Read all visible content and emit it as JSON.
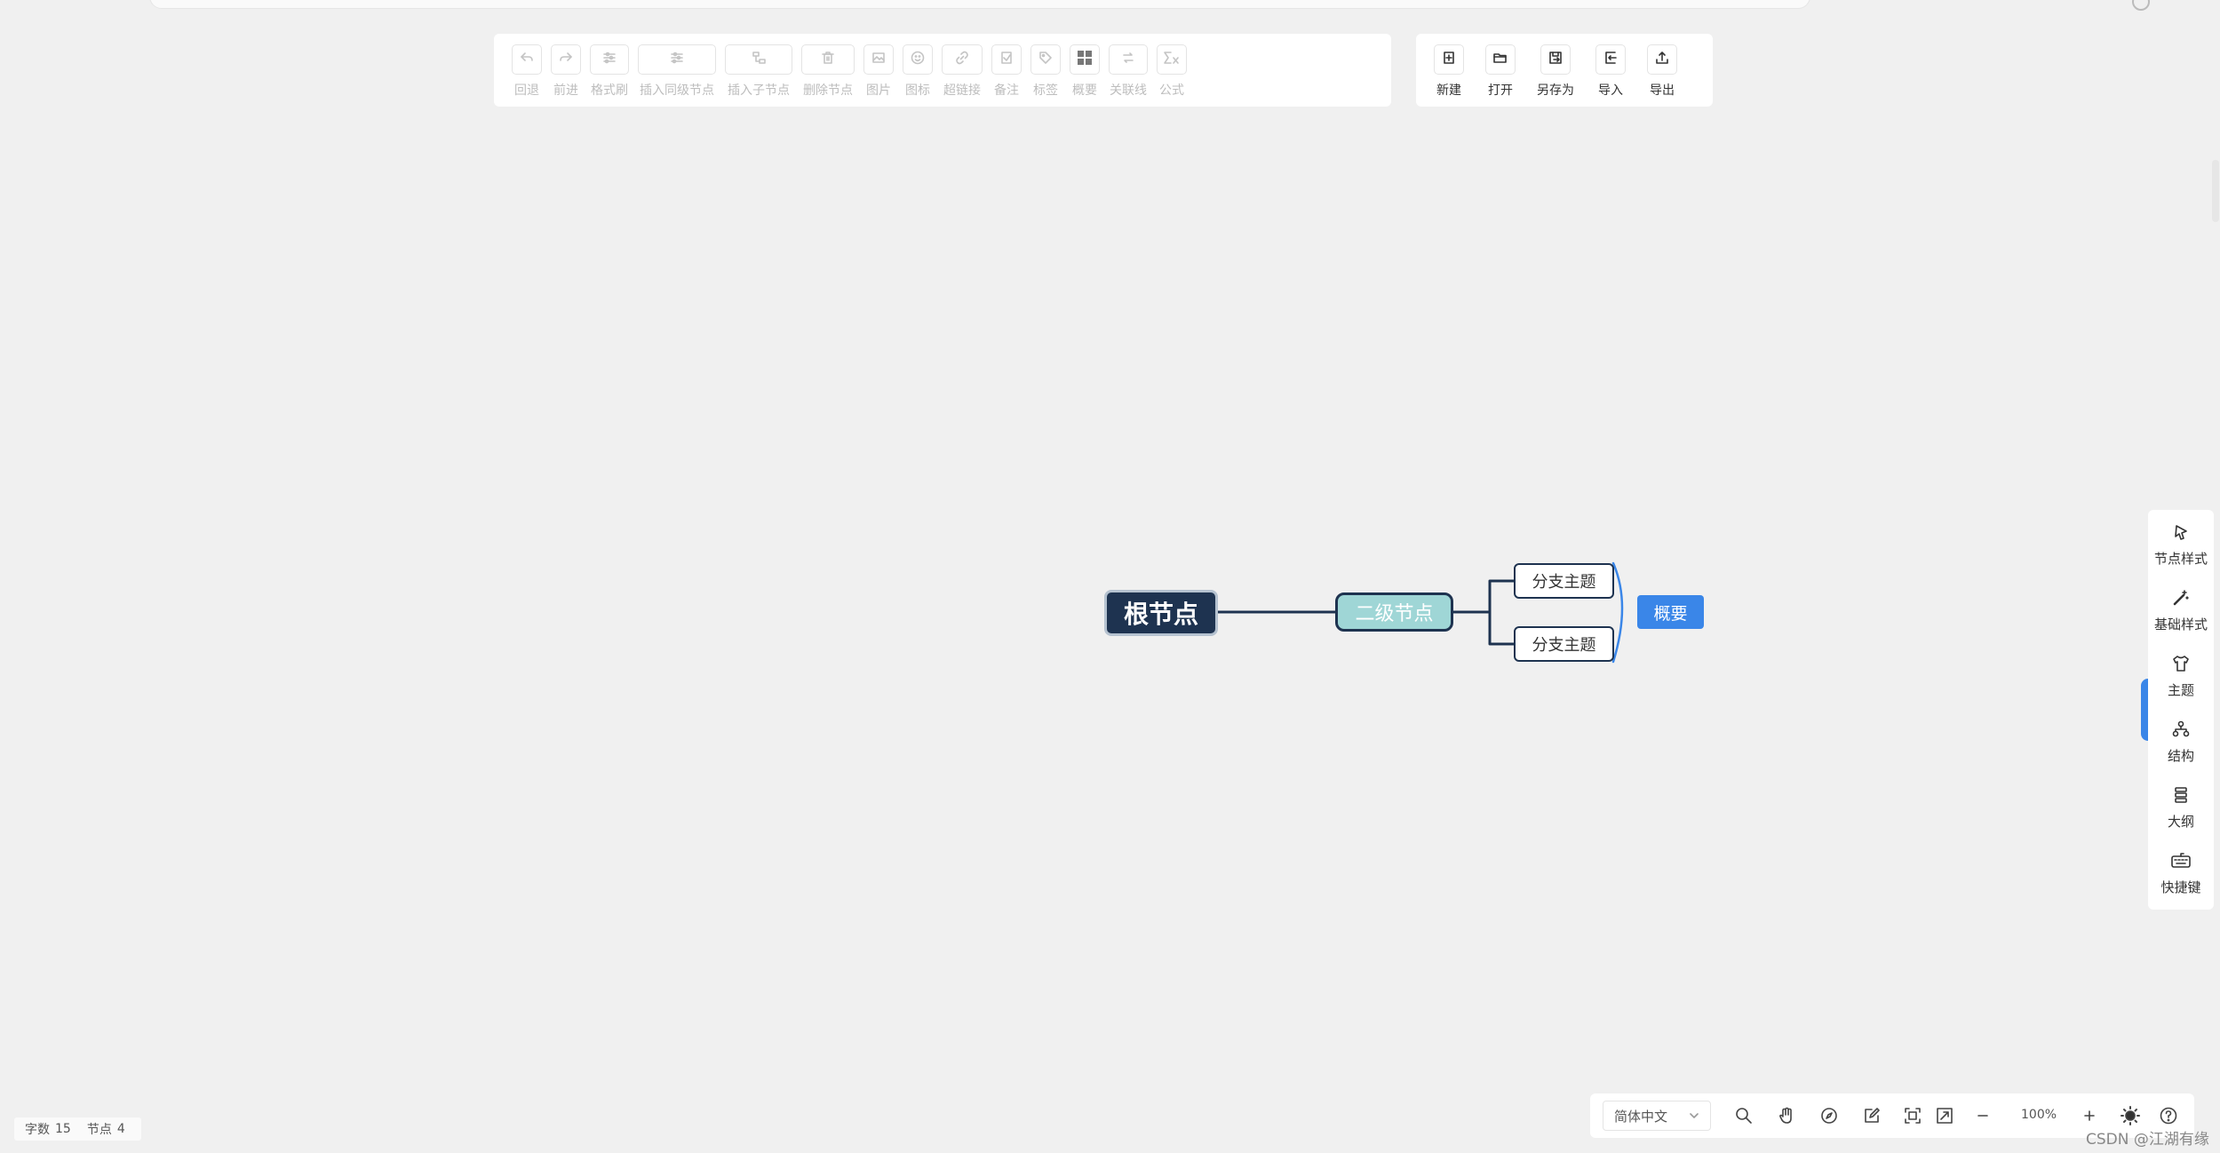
{
  "edit_toolbar": {
    "undo": "回退",
    "redo": "前进",
    "format_brush": "格式刷",
    "insert_sibling": "插入同级节点",
    "insert_child": "插入子节点",
    "delete_node": "删除节点",
    "image": "图片",
    "icon": "图标",
    "hyperlink": "超链接",
    "note": "备注",
    "tag": "标签",
    "summary": "概要",
    "relation_line": "关联线",
    "formula": "公式"
  },
  "file_toolbar": {
    "new": "新建",
    "open": "打开",
    "save_as": "另存为",
    "import": "导入",
    "export": "导出"
  },
  "mindmap": {
    "root": "根节点",
    "second_level": "二级节点",
    "branch_1": "分支主题",
    "branch_2": "分支主题",
    "summary": "概要",
    "colors": {
      "root_bg": "#1e3350",
      "second_bg": "#9fd6d6",
      "summary_bg": "#3a86e8",
      "line": "#1e3350"
    }
  },
  "side_panel": {
    "node_style": "节点样式",
    "base_style": "基础样式",
    "theme": "主题",
    "structure": "结构",
    "outline": "大纲",
    "shortcuts": "快捷键"
  },
  "status_bar": {
    "word_count_label": "字数",
    "word_count": "15",
    "node_count_label": "节点",
    "node_count": "4"
  },
  "bottom_toolbar": {
    "language": "简体中文",
    "zoom": "100%",
    "icons": [
      "search-icon",
      "hand-drag-icon",
      "compass-icon",
      "edit-icon",
      "fullscreen-icon",
      "fit-canvas-icon",
      "zoom-out-icon",
      "zoom-in-icon",
      "sun-theme-icon",
      "help-icon"
    ]
  },
  "watermark": "CSDN @江湖有缘"
}
